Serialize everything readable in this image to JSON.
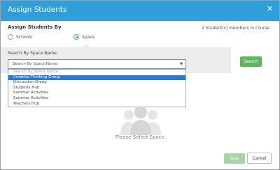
{
  "header": {
    "title": "Assign Students",
    "close_icon": "close-icon"
  },
  "assign": {
    "label": "Assign Students By",
    "member_count": "2 Student(s) members in course",
    "options": [
      {
        "label": "Schools",
        "checked": false
      },
      {
        "label": "Space",
        "checked": true
      }
    ]
  },
  "search": {
    "label": "Search By Space Name",
    "select_value": "Search By Space Name",
    "dropdown_options": [
      {
        "label": "Search By Space Name",
        "state": "placeholder"
      },
      {
        "label": "Creative Thinking Group",
        "state": "selected"
      },
      {
        "label": "Discussion Group",
        "state": "normal"
      },
      {
        "label": "Students Hub",
        "state": "normal"
      },
      {
        "label": "Summer Activities",
        "state": "normal"
      },
      {
        "label": "Summer Activities",
        "state": "normal"
      },
      {
        "label": "Teachers Hub",
        "state": "normal"
      }
    ],
    "button_label": "Search"
  },
  "empty_state": {
    "icon": "group-placeholder-icon",
    "text": "Please Select Space."
  },
  "footer": {
    "save_label": "Save",
    "cancel_label": "Cancel"
  },
  "colors": {
    "header": "#2f9fdc",
    "accent_green": "#5cb85c",
    "selected_option": "#2d79d1"
  }
}
